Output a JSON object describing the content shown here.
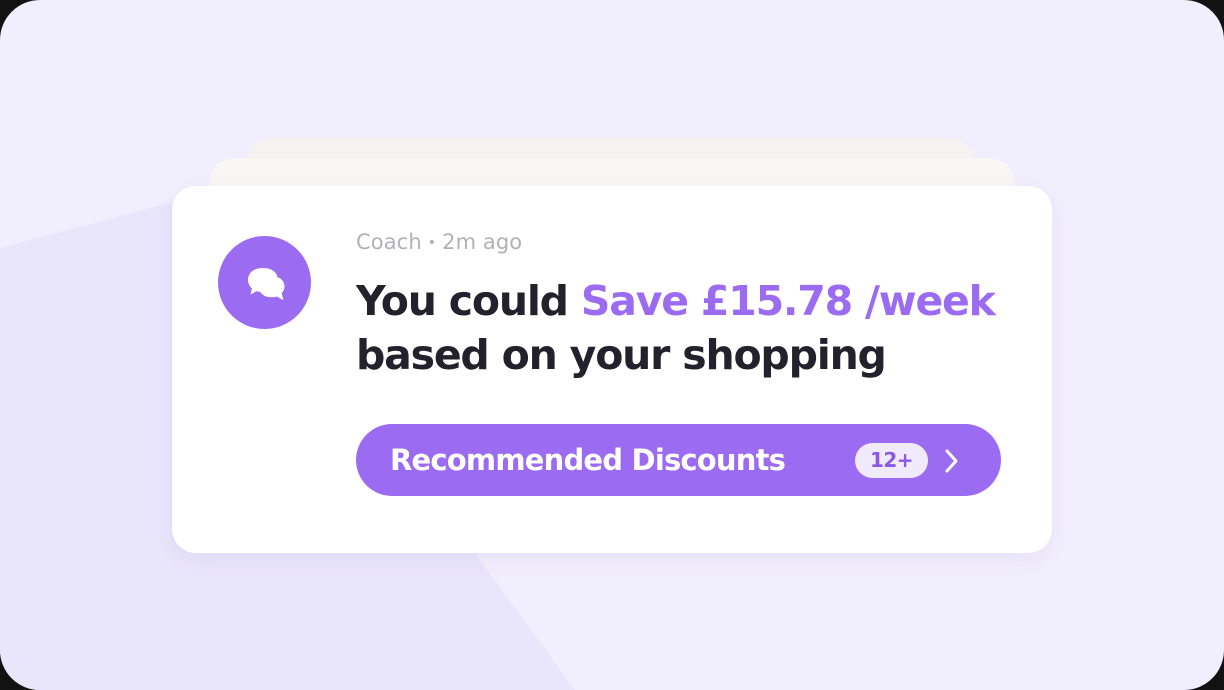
{
  "colors": {
    "accent": "#9b6cf2",
    "background": "#f1eefd",
    "card": "#ffffff",
    "headline_text": "#23212b",
    "meta_text": "#b1b1b7",
    "badge_bg": "#f1eafd"
  },
  "notification": {
    "avatar_icon": "chat-bubbles-icon",
    "sender": "Coach",
    "separator": "•",
    "time": "2m ago",
    "headline_prefix": "You could ",
    "headline_accent": "Save £15.78 /week",
    "headline_suffix": "based on your shopping",
    "cta": {
      "label": "Recommended Discounts",
      "badge": "12+",
      "icon": "chevron-right-icon"
    }
  }
}
